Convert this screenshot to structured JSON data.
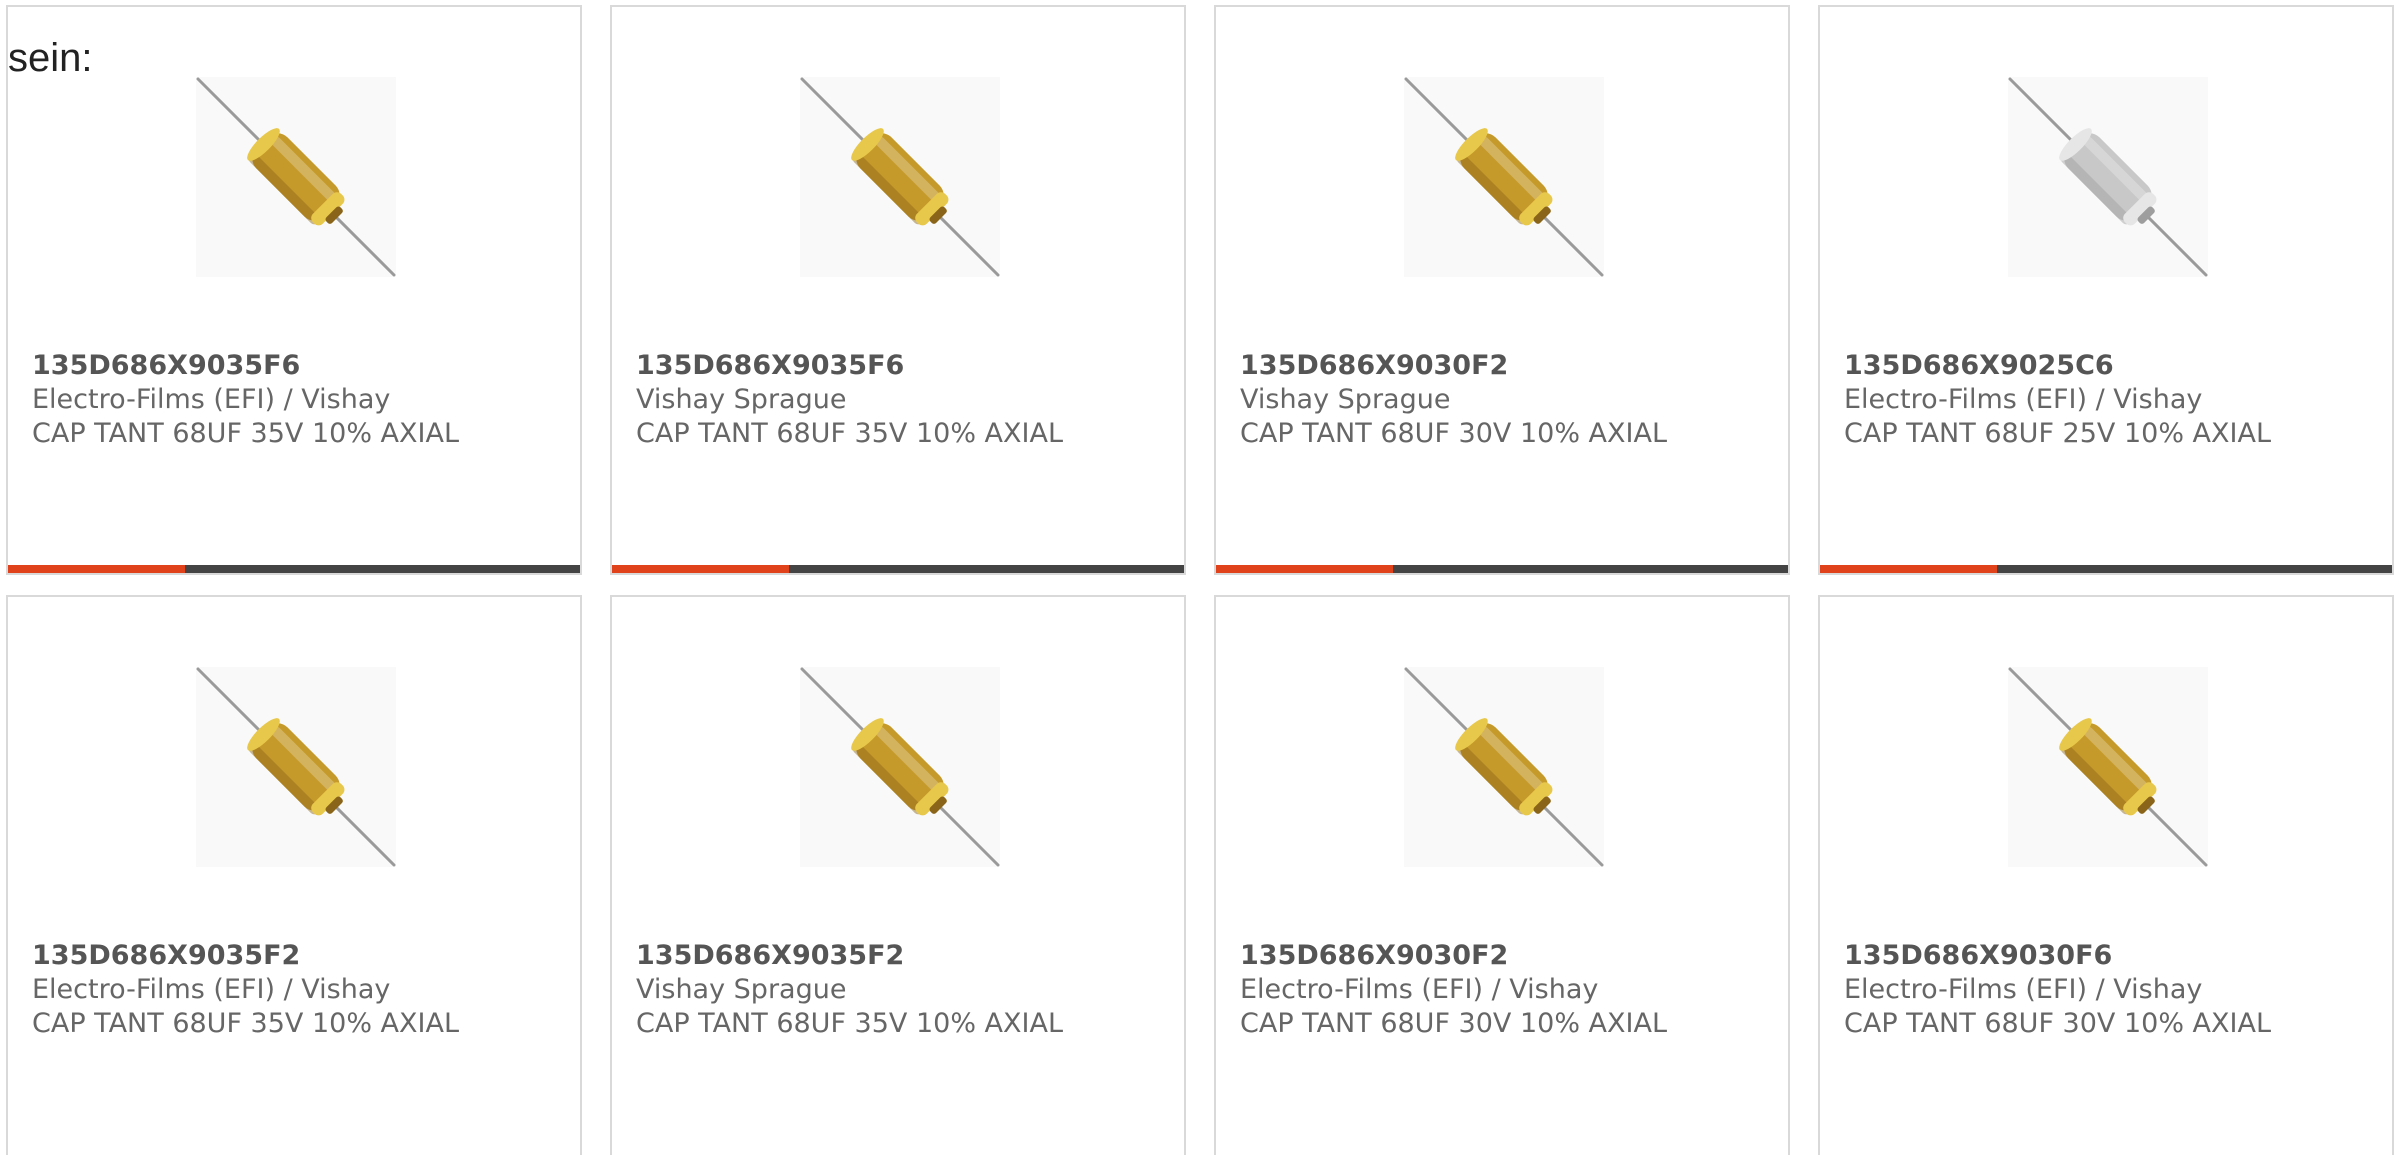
{
  "lead_text": "sein:",
  "colors": {
    "accent": "#e0421b",
    "track": "#444444",
    "capacitor_body": "#c69a2a",
    "capacitor_body_grey": "#c8c8c8",
    "lead_wire": "#9a9a9a"
  },
  "products": [
    {
      "part_number": "135D686X9035F6",
      "manufacturer": "Electro-Films (EFI) / Vishay",
      "description": "CAP TANT 68UF 35V 10% AXIAL",
      "image_icon": "axial-capacitor-amber-icon",
      "progress": 0.31
    },
    {
      "part_number": "135D686X9035F6",
      "manufacturer": "Vishay Sprague",
      "description": "CAP TANT 68UF 35V 10% AXIAL",
      "image_icon": "axial-capacitor-amber-icon",
      "progress": 0.31
    },
    {
      "part_number": "135D686X9030F2",
      "manufacturer": "Vishay Sprague",
      "description": "CAP TANT 68UF 30V 10% AXIAL",
      "image_icon": "axial-capacitor-amber-icon",
      "progress": 0.31
    },
    {
      "part_number": "135D686X9025C6",
      "manufacturer": "Electro-Films (EFI) / Vishay",
      "description": "CAP TANT 68UF 25V 10% AXIAL",
      "image_icon": "axial-capacitor-grey-icon",
      "progress": 0.31
    },
    {
      "part_number": "135D686X9035F2",
      "manufacturer": "Electro-Films (EFI) / Vishay",
      "description": "CAP TANT 68UF 35V 10% AXIAL",
      "image_icon": "axial-capacitor-amber-icon"
    },
    {
      "part_number": "135D686X9035F2",
      "manufacturer": "Vishay Sprague",
      "description": "CAP TANT 68UF 35V 10% AXIAL",
      "image_icon": "axial-capacitor-amber-icon"
    },
    {
      "part_number": "135D686X9030F2",
      "manufacturer": "Electro-Films (EFI) / Vishay",
      "description": "CAP TANT 68UF 30V 10% AXIAL",
      "image_icon": "axial-capacitor-amber-icon"
    },
    {
      "part_number": "135D686X9030F6",
      "manufacturer": "Electro-Films (EFI) / Vishay",
      "description": "CAP TANT 68UF 30V 10% AXIAL",
      "image_icon": "axial-capacitor-amber-icon"
    }
  ]
}
